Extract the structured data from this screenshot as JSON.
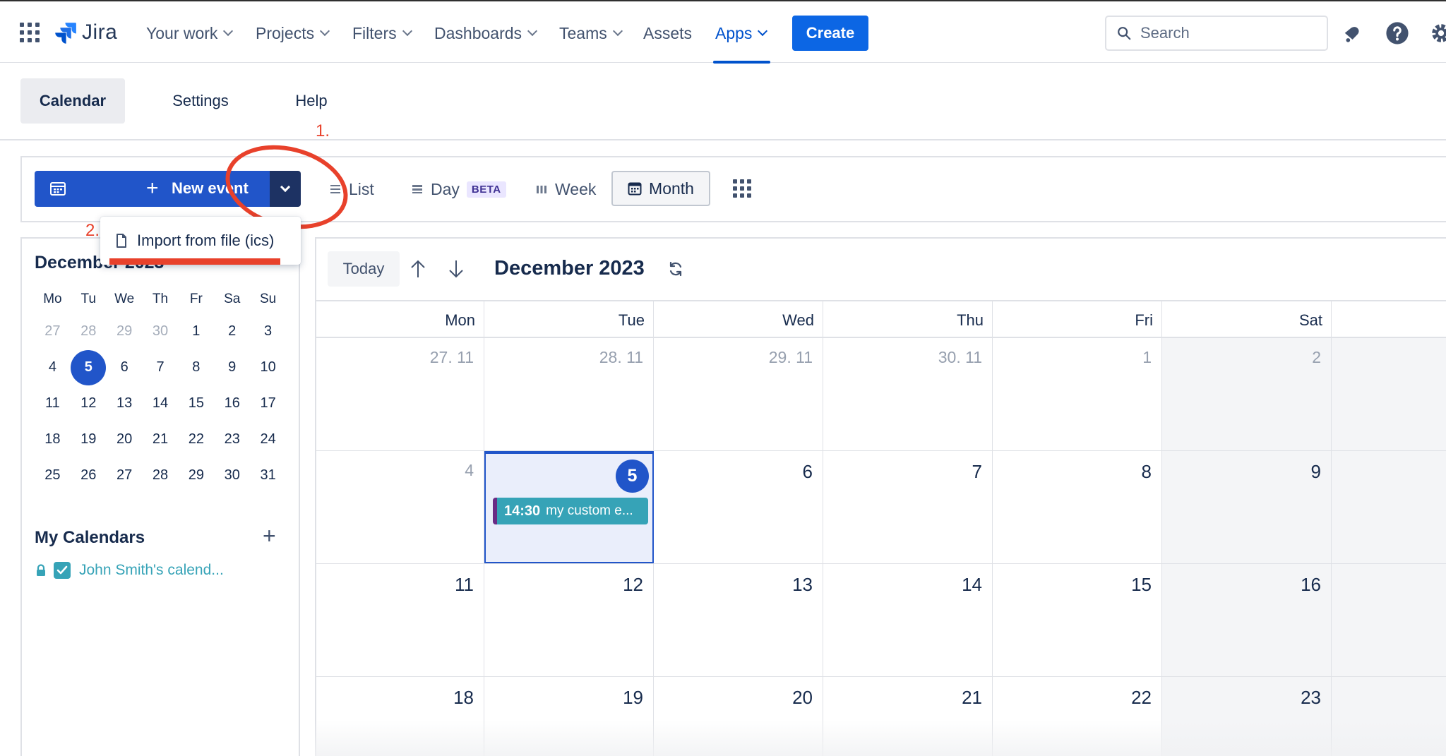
{
  "topnav": {
    "brand": "Jira",
    "items": [
      {
        "label": "Your work",
        "dropdown": true
      },
      {
        "label": "Projects",
        "dropdown": true
      },
      {
        "label": "Filters",
        "dropdown": true
      },
      {
        "label": "Dashboards",
        "dropdown": true
      },
      {
        "label": "Teams",
        "dropdown": true
      },
      {
        "label": "Assets",
        "dropdown": false
      },
      {
        "label": "Apps",
        "dropdown": true,
        "active": true
      }
    ],
    "create_label": "Create",
    "search_placeholder": "Search"
  },
  "subnav": {
    "tabs": [
      {
        "label": "Calendar",
        "selected": true
      },
      {
        "label": "Settings",
        "selected": false
      },
      {
        "label": "Help",
        "selected": false
      }
    ]
  },
  "annotations": {
    "step1": "1.",
    "step2": "2.",
    "color": "#e8412b"
  },
  "toolbar": {
    "new_event_label": "New event",
    "views": {
      "list": "List",
      "day": "Day",
      "day_badge": "BETA",
      "week": "Week",
      "month": "Month"
    },
    "selected_view": "Month"
  },
  "dropdown_menu": {
    "items": [
      {
        "label": "Import from file (ics)",
        "icon": "file-icon"
      }
    ]
  },
  "mini_calendar": {
    "title": "December 2023",
    "weekday_headers": [
      "Mo",
      "Tu",
      "We",
      "Th",
      "Fr",
      "Sa",
      "Su"
    ],
    "weeks": [
      [
        {
          "d": "27",
          "muted": true
        },
        {
          "d": "28",
          "muted": true
        },
        {
          "d": "29",
          "muted": true
        },
        {
          "d": "30",
          "muted": true
        },
        {
          "d": "1"
        },
        {
          "d": "2"
        },
        {
          "d": "3"
        }
      ],
      [
        {
          "d": "4"
        },
        {
          "d": "5",
          "today": true
        },
        {
          "d": "6"
        },
        {
          "d": "7"
        },
        {
          "d": "8"
        },
        {
          "d": "9"
        },
        {
          "d": "10"
        }
      ],
      [
        {
          "d": "11"
        },
        {
          "d": "12"
        },
        {
          "d": "13"
        },
        {
          "d": "14"
        },
        {
          "d": "15"
        },
        {
          "d": "16"
        },
        {
          "d": "17"
        }
      ],
      [
        {
          "d": "18"
        },
        {
          "d": "19"
        },
        {
          "d": "20"
        },
        {
          "d": "21"
        },
        {
          "d": "22"
        },
        {
          "d": "23"
        },
        {
          "d": "24"
        }
      ],
      [
        {
          "d": "25"
        },
        {
          "d": "26"
        },
        {
          "d": "27"
        },
        {
          "d": "28"
        },
        {
          "d": "29"
        },
        {
          "d": "30"
        },
        {
          "d": "31"
        }
      ]
    ]
  },
  "my_calendars": {
    "title": "My Calendars",
    "add_label": "+",
    "items": [
      {
        "name": "John Smith's calend...",
        "checked": true,
        "locked": true,
        "color": "#36a3b7"
      }
    ]
  },
  "calendar": {
    "today_label": "Today",
    "month_title": "December 2023",
    "weekday_headers": [
      "Mon",
      "Tue",
      "Wed",
      "Thu",
      "Fri",
      "Sat"
    ],
    "weeks": [
      [
        {
          "d": "27. 11",
          "muted": true
        },
        {
          "d": "28. 11",
          "muted": true
        },
        {
          "d": "29. 11",
          "muted": true
        },
        {
          "d": "30. 11",
          "muted": true
        },
        {
          "d": "1",
          "muted": true
        },
        {
          "d": "2",
          "muted": true,
          "weekend": true
        }
      ],
      [
        {
          "d": "4",
          "muted": true
        },
        {
          "d": "5",
          "today": true,
          "events": [
            {
              "time": "14:30",
              "title": "my custom e..."
            }
          ]
        },
        {
          "d": "6"
        },
        {
          "d": "7"
        },
        {
          "d": "8"
        },
        {
          "d": "9",
          "weekend": true
        }
      ],
      [
        {
          "d": "11"
        },
        {
          "d": "12"
        },
        {
          "d": "13"
        },
        {
          "d": "14"
        },
        {
          "d": "15"
        },
        {
          "d": "16",
          "weekend": true
        }
      ],
      [
        {
          "d": "18"
        },
        {
          "d": "19"
        },
        {
          "d": "20"
        },
        {
          "d": "21"
        },
        {
          "d": "22"
        },
        {
          "d": "23",
          "weekend": true
        }
      ]
    ]
  },
  "colors": {
    "primary": "#2155c9",
    "create": "#0c66e4",
    "event": "#36a3b7",
    "event_border": "#6a2b85",
    "nav_active": "#0052cc"
  }
}
